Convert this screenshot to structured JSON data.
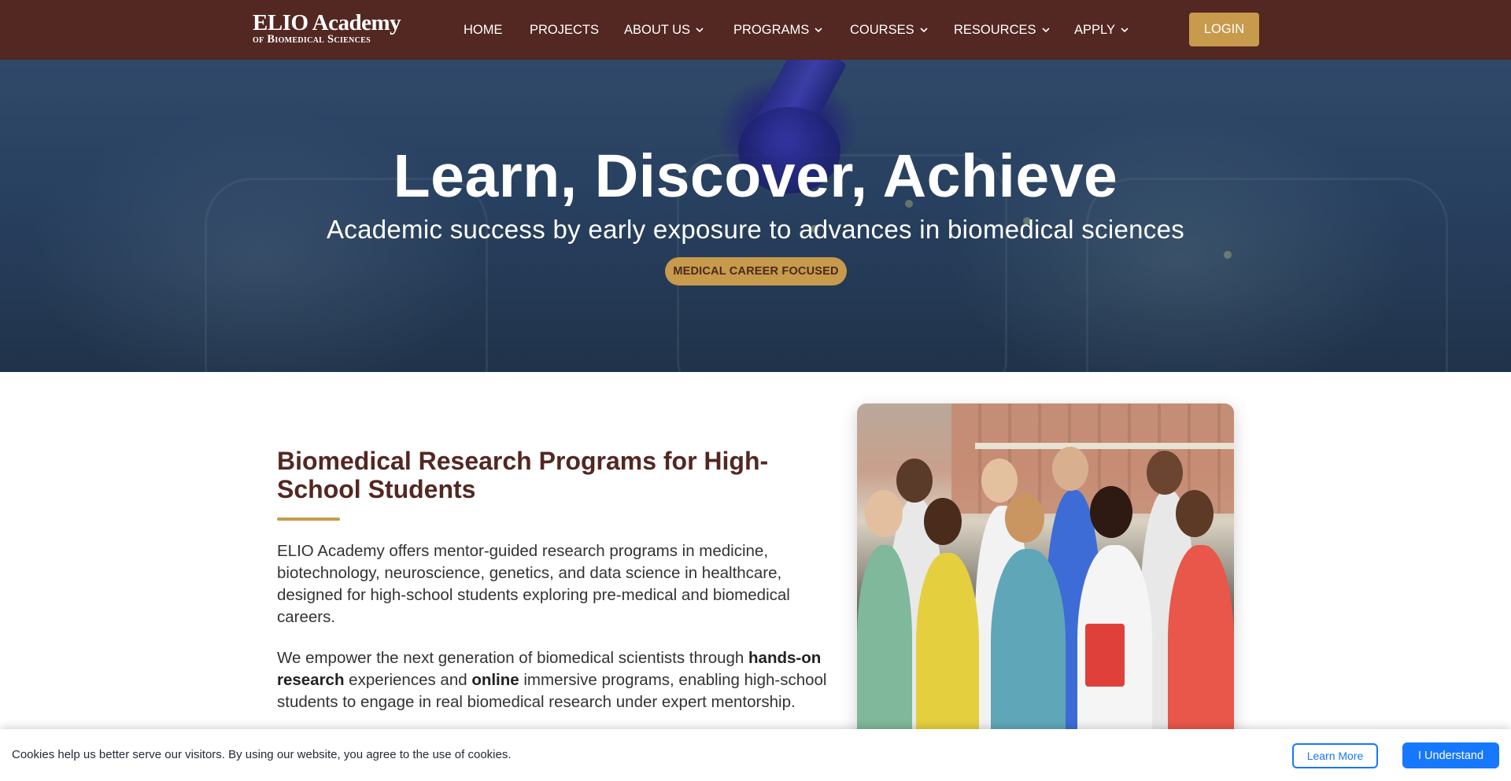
{
  "nav": {
    "logo_line1": "ELIO Academy",
    "logo_line2": "of Biomedical Sciences",
    "items": [
      {
        "label": "HOME",
        "has_dropdown": false
      },
      {
        "label": "PROJECTS",
        "has_dropdown": false
      },
      {
        "label": "ABOUT US",
        "has_dropdown": true
      },
      {
        "label": "PROGRAMS",
        "has_dropdown": true
      },
      {
        "label": "COURSES",
        "has_dropdown": true
      },
      {
        "label": "RESOURCES",
        "has_dropdown": true
      },
      {
        "label": "APPLY",
        "has_dropdown": true
      }
    ],
    "login_label": "LOGIN"
  },
  "hero": {
    "title": "Learn, Discover, Achieve",
    "subtitle": "Academic success by early exposure to advances in biomedical sciences",
    "badge": "MEDICAL CAREER FOCUSED"
  },
  "intro": {
    "title": "Biomedical Research Programs for High-School Students",
    "paragraph1": "ELIO Academy offers mentor-guided research programs in medicine, biotechnology, neuroscience, genetics, and data science in healthcare, designed for high-school students exploring pre-medical and biomedical careers.",
    "paragraph2": {
      "part1": "We empower the next generation of biomedical scientists through ",
      "bold1": "hands-on research",
      "part2": " experiences and ",
      "bold2": "online",
      "part3": " immersive programs, enabling high-school students to engage in real biomedical research under expert mentorship."
    }
  },
  "cookie": {
    "text": "Cookies help us better serve our visitors. By using our website, you agree to the use of cookies.",
    "learn_more": "Learn More",
    "accept": "I Understand"
  },
  "colors": {
    "nav_bg": "#532722",
    "accent_gold": "#c79a4c",
    "heading_brown": "#532722",
    "cookie_blue": "#1677ff"
  }
}
